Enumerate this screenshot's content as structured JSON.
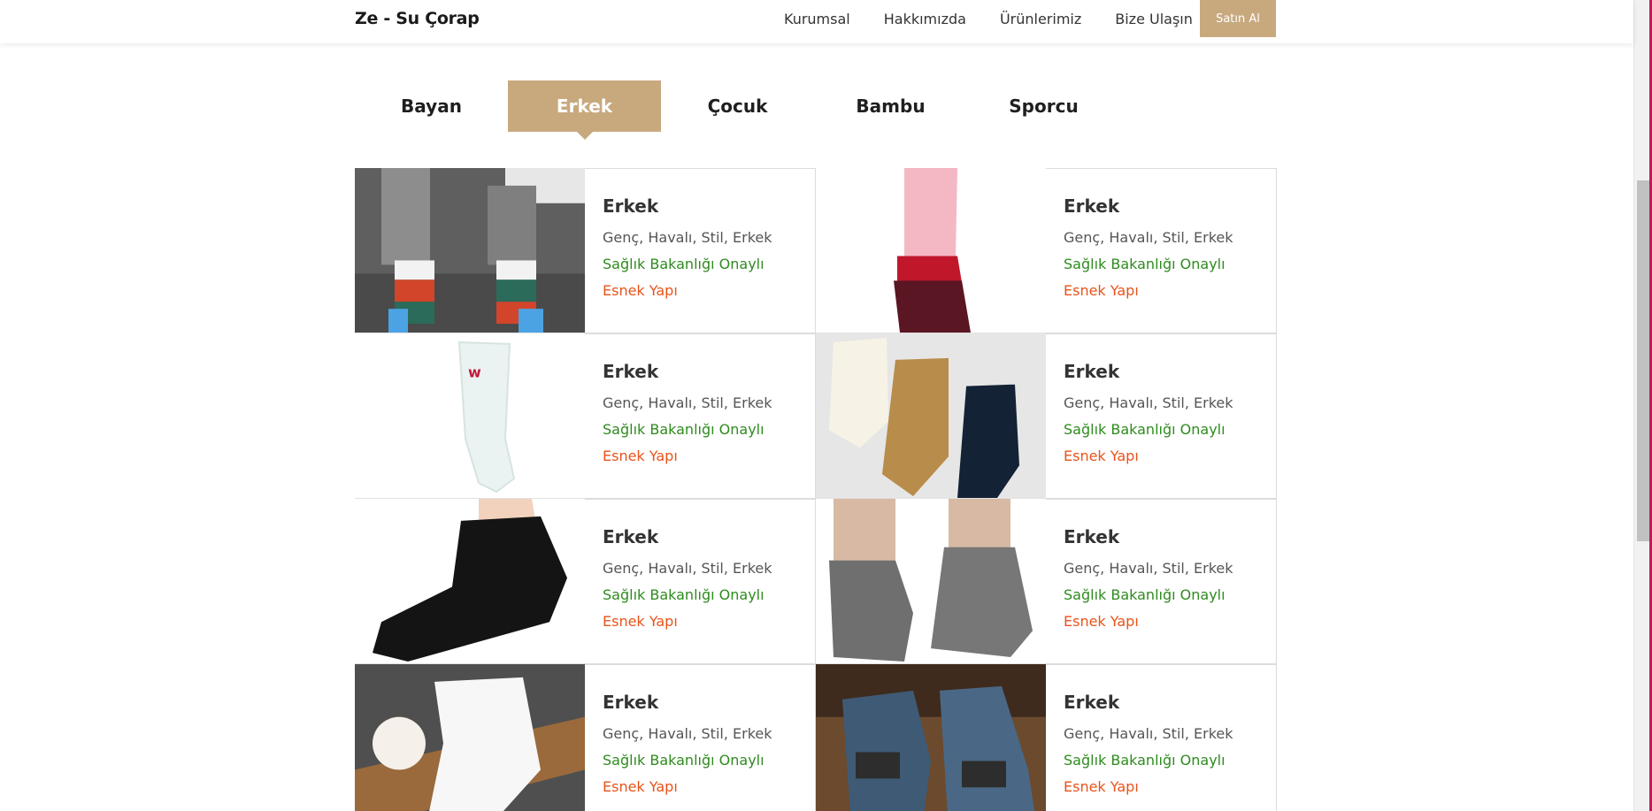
{
  "header": {
    "brand": "Ze - Su Çorap",
    "nav": [
      "Kurumsal",
      "Hakkımızda",
      "Ürünlerimiz",
      "Bize Ulaşın"
    ],
    "buy_label": "Satın Al",
    "accent_color": "#c8a97e"
  },
  "tabs": [
    {
      "label": "Bayan",
      "active": false
    },
    {
      "label": "Erkek",
      "active": true
    },
    {
      "label": "Çocuk",
      "active": false
    },
    {
      "label": "Bambu",
      "active": false
    },
    {
      "label": "Sporcu",
      "active": false
    }
  ],
  "products": [
    {
      "title": "Erkek",
      "desc": "Genç, Havalı, Stil, Erkek",
      "badge_health": "Sağlık Bakanlığı Onaylı",
      "badge_flex": "Esnek Yapı",
      "image": "colorful-striped-socks-photo"
    },
    {
      "title": "Erkek",
      "desc": "Genç, Havalı, Stil, Erkek",
      "badge_health": "Sağlık Bakanlığı Onaylı",
      "badge_flex": "Esnek Yapı",
      "image": "red-ankle-sock-photo"
    },
    {
      "title": "Erkek",
      "desc": "Genç, Havalı, Stil, Erkek",
      "badge_health": "Sağlık Bakanlığı Onaylı",
      "badge_flex": "Esnek Yapı",
      "image": "white-crew-sock-photo"
    },
    {
      "title": "Erkek",
      "desc": "Genç, Havalı, Stil, Erkek",
      "badge_health": "Sağlık Bakanlığı Onaylı",
      "badge_flex": "Esnek Yapı",
      "image": "three-colored-socks-photo"
    },
    {
      "title": "Erkek",
      "desc": "Genç, Havalı, Stil, Erkek",
      "badge_health": "Sağlık Bakanlığı Onaylı",
      "badge_flex": "Esnek Yapı",
      "image": "black-low-cut-sock-photo"
    },
    {
      "title": "Erkek",
      "desc": "Genç, Havalı, Stil, Erkek",
      "badge_health": "Sağlık Bakanlığı Onaylı",
      "badge_flex": "Esnek Yapı",
      "image": "grey-grip-socks-photo"
    },
    {
      "title": "Erkek",
      "desc": "Genç, Havalı, Stil, Erkek",
      "badge_health": "Sağlık Bakanlığı Onaylı",
      "badge_flex": "Esnek Yapı",
      "image": "white-ankle-sock-photo"
    },
    {
      "title": "Erkek",
      "desc": "Genç, Havalı, Stil, Erkek",
      "badge_health": "Sağlık Bakanlığı Onaylı",
      "badge_flex": "Esnek Yapı",
      "image": "blue-sport-sock-photo"
    }
  ],
  "colors": {
    "health_badge": "#2e8b1e",
    "flex_badge": "#e8531a"
  }
}
